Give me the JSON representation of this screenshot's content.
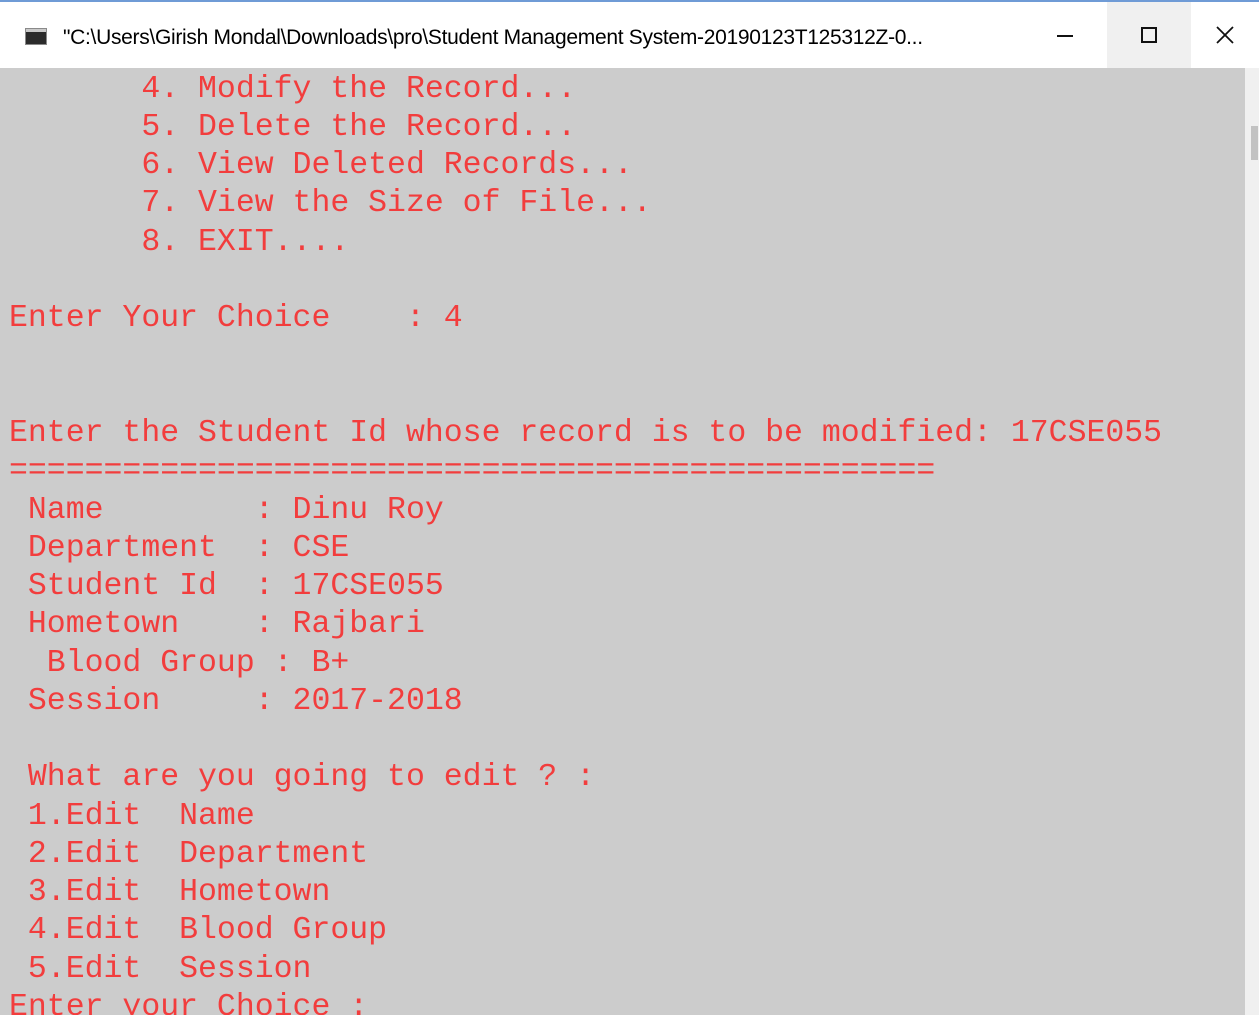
{
  "window": {
    "title": "\"C:\\Users\\Girish Mondal\\Downloads\\pro\\Student Management System-20190123T125312Z-0...",
    "icons": {
      "app": "console-app-icon",
      "minimize": "minimize-icon",
      "maximize": "maximize-icon",
      "close": "close-icon"
    }
  },
  "colors": {
    "console_background": "#cccccc",
    "console_text": "#f23d3d",
    "title_bar": "#ffffff"
  },
  "console": {
    "lines": [
      "       4. Modify the Record...",
      "       5. Delete the Record...",
      "       6. View Deleted Records...",
      "       7. View the Size of File...",
      "       8. EXIT....",
      "",
      "Enter Your Choice    : 4",
      "",
      "",
      "Enter the Student Id whose record is to be modified: 17CSE055",
      "=================================================",
      " Name        : Dinu Roy",
      " Department  : CSE",
      " Student Id  : 17CSE055",
      " Hometown    : Rajbari",
      "  Blood Group : B+",
      " Session     : 2017-2018",
      "",
      " What are you going to edit ? :",
      " 1.Edit  Name",
      " 2.Edit  Department",
      " 3.Edit  Hometown",
      " 4.Edit  Blood Group",
      " 5.Edit  Session",
      "Enter your Choice :"
    ]
  }
}
